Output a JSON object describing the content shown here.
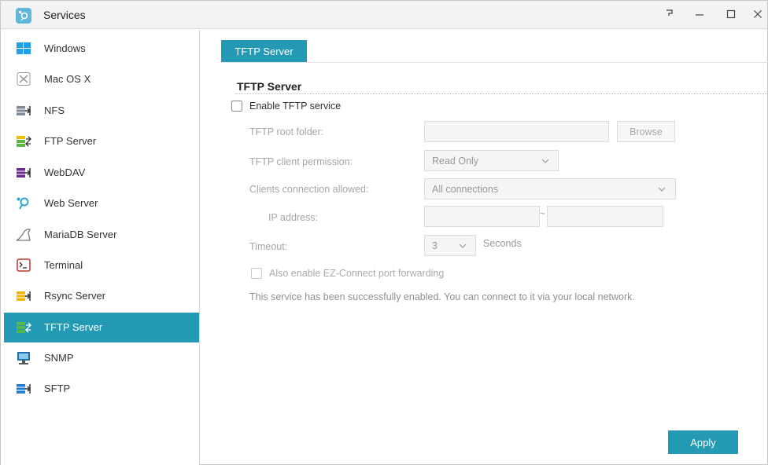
{
  "window": {
    "title": "Services",
    "help_icon": "help-icon",
    "minimize_icon": "minimize-icon",
    "maximize_icon": "maximize-icon",
    "close_icon": "close-icon"
  },
  "sidebar": {
    "items": [
      {
        "label": "Windows",
        "icon": "windows-icon",
        "active": false
      },
      {
        "label": "Mac OS X",
        "icon": "mac-icon",
        "active": false
      },
      {
        "label": "NFS",
        "icon": "nfs-icon",
        "active": false
      },
      {
        "label": "FTP Server",
        "icon": "ftp-icon",
        "active": false
      },
      {
        "label": "WebDAV",
        "icon": "webdav-icon",
        "active": false
      },
      {
        "label": "Web Server",
        "icon": "web-server-icon",
        "active": false
      },
      {
        "label": "MariaDB Server",
        "icon": "mariadb-icon",
        "active": false
      },
      {
        "label": "Terminal",
        "icon": "terminal-icon",
        "active": false
      },
      {
        "label": "Rsync Server",
        "icon": "rsync-icon",
        "active": false
      },
      {
        "label": "TFTP Server",
        "icon": "tftp-icon",
        "active": true
      },
      {
        "label": "SNMP",
        "icon": "snmp-icon",
        "active": false
      },
      {
        "label": "SFTP",
        "icon": "sftp-icon",
        "active": false
      }
    ]
  },
  "main": {
    "tab_label": "TFTP Server",
    "section_title": "TFTP Server",
    "enable_label": "Enable TFTP service",
    "enable_checked": false,
    "root_folder_label": "TFTP root folder:",
    "root_folder_value": "",
    "browse_label": "Browse",
    "permission_label": "TFTP client permission:",
    "permission_value": "Read Only",
    "connections_label": "Clients connection allowed:",
    "connections_value": "All connections",
    "ip_label": "IP address:",
    "ip_start": "",
    "ip_end": "",
    "ip_separator": "~",
    "timeout_label": "Timeout:",
    "timeout_value": "3",
    "timeout_unit": "Seconds",
    "ezconnect_label": "Also enable EZ-Connect port forwarding",
    "ezconnect_checked": false,
    "info_text": "This service has been successfully enabled. You can connect to it via your local network.",
    "apply_label": "Apply"
  },
  "colors": {
    "accent": "#2499b3"
  }
}
